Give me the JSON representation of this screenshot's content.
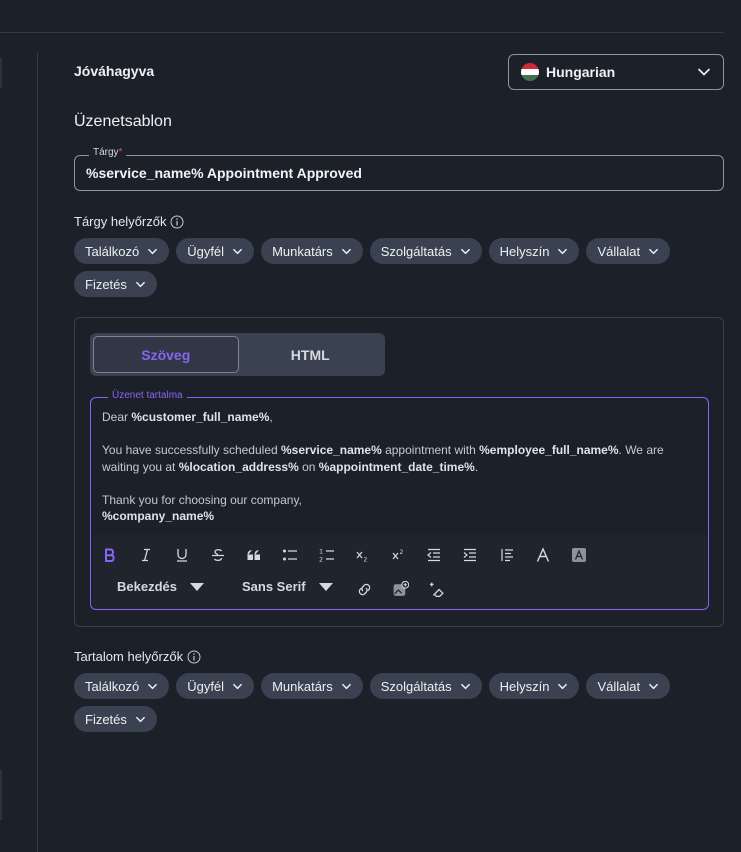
{
  "status_title": "Jóváhagyva",
  "language": {
    "label": "Hungarian",
    "flag_colors": [
      "#ce2939",
      "#ffffff",
      "#477050"
    ]
  },
  "template_heading": "Üzenetsablon",
  "subject": {
    "label": "Tárgy",
    "required_mark": "*",
    "value": "%service_name% Appointment Approved"
  },
  "subject_placeholders": {
    "label": "Tárgy helyőrzők",
    "chips": [
      "Találkozó",
      "Ügyfél",
      "Munkatárs",
      "Szolgáltatás",
      "Helyszín",
      "Vállalat",
      "Fizetés"
    ]
  },
  "editor": {
    "tabs": [
      {
        "label": "Szöveg",
        "active": true
      },
      {
        "label": "HTML",
        "active": false
      }
    ],
    "content_label": "Üzenet tartalma",
    "content": {
      "l1_a": "Dear ",
      "l1_b": "%customer_full_name%",
      "l1_c": ",",
      "l3_a": "You have successfully scheduled ",
      "l3_b": "%service_name%",
      "l3_c": " appointment with ",
      "l3_d": "%employee_full_name%",
      "l3_e": ". We are waiting you at ",
      "l3_f": "%location_address%",
      "l3_g": " on ",
      "l3_h": "%appointment_date_time%",
      "l3_i": ".",
      "l5": "Thank you for choosing our company,",
      "l6": "%company_name%"
    },
    "toolbar": {
      "paragraph_select": "Bekezdés",
      "font_select": "Sans Serif",
      "bold_color": "#8a63f5"
    }
  },
  "content_placeholders": {
    "label": "Tartalom helyőrzők",
    "chips": [
      "Találkozó",
      "Ügyfél",
      "Munkatárs",
      "Szolgáltatás",
      "Helyszín",
      "Vállalat",
      "Fizetés"
    ]
  },
  "colors": {
    "accent": "#8a63f5",
    "background": "#1c2029",
    "chip": "#3a4150",
    "required": "#e5484d"
  }
}
